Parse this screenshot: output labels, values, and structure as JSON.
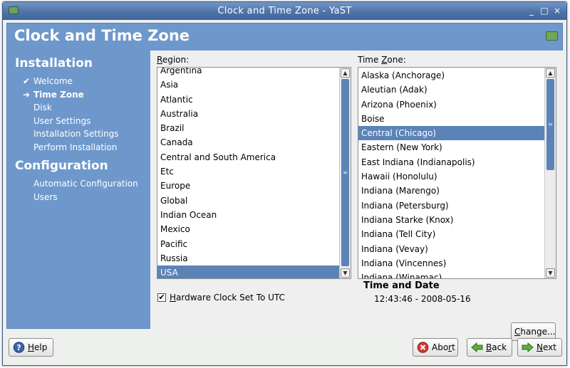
{
  "window": {
    "title": "Clock and Time Zone - YaST",
    "min_glyph": "_",
    "max_glyph": "□",
    "close_glyph": "×"
  },
  "header": {
    "title": "Clock and Time Zone"
  },
  "sidebar": {
    "installation_title": "Installation",
    "installation_steps": [
      {
        "label": "Welcome",
        "mark": "✔",
        "state": "done"
      },
      {
        "label": "Time Zone",
        "mark": "➜",
        "state": "current"
      },
      {
        "label": "Disk",
        "mark": "",
        "state": "pending"
      },
      {
        "label": "User Settings",
        "mark": "",
        "state": "pending"
      },
      {
        "label": "Installation Settings",
        "mark": "",
        "state": "pending"
      },
      {
        "label": "Perform Installation",
        "mark": "",
        "state": "pending"
      }
    ],
    "configuration_title": "Configuration",
    "configuration_steps": [
      {
        "label": "Automatic Configuration"
      },
      {
        "label": "Users"
      }
    ]
  },
  "region": {
    "label_accel": "R",
    "label_rest": "egion:",
    "items": [
      "Argentina",
      "Asia",
      "Atlantic",
      "Australia",
      "Brazil",
      "Canada",
      "Central and South America",
      "Etc",
      "Europe",
      "Global",
      "Indian Ocean",
      "Mexico",
      "Pacific",
      "Russia",
      "USA"
    ],
    "selected": "USA"
  },
  "timezone": {
    "label_pre": "Time ",
    "label_accel": "Z",
    "label_rest": "one:",
    "items": [
      "Alaska (Anchorage)",
      "Aleutian (Adak)",
      "Arizona (Phoenix)",
      "Boise",
      "Central (Chicago)",
      "Eastern (New York)",
      "East Indiana (Indianapolis)",
      "Hawaii (Honolulu)",
      "Indiana (Marengo)",
      "Indiana (Petersburg)",
      "Indiana Starke (Knox)",
      "Indiana (Tell City)",
      "Indiana (Vevay)",
      "Indiana (Vincennes)",
      "Indiana (Winamac)"
    ],
    "selected": "Central (Chicago)"
  },
  "hardware_clock": {
    "accel": "H",
    "label_rest": "ardware Clock Set To UTC",
    "checked": true,
    "check_glyph": "✔"
  },
  "time_and_date": {
    "title": "Time and Date",
    "value": "12:43:46 - 2008-05-16"
  },
  "buttons": {
    "change": {
      "accel": "C",
      "rest": "hange..."
    },
    "help": {
      "accel": "H",
      "rest": "elp"
    },
    "abort": {
      "pre": "Abo",
      "accel": "r",
      "rest": "t"
    },
    "back": {
      "accel": "B",
      "rest": "ack"
    },
    "next": {
      "accel": "N",
      "rest": "ext"
    }
  },
  "colors": {
    "accent": "#6e98cc",
    "selection": "#5b83b8",
    "titlebar": "#4e73a8"
  },
  "icons": {
    "app": "yast-icon",
    "heading": "timezone-map-icon",
    "help": "help-icon",
    "abort": "abort-icon",
    "back": "back-arrow-icon",
    "next": "next-arrow-icon"
  }
}
